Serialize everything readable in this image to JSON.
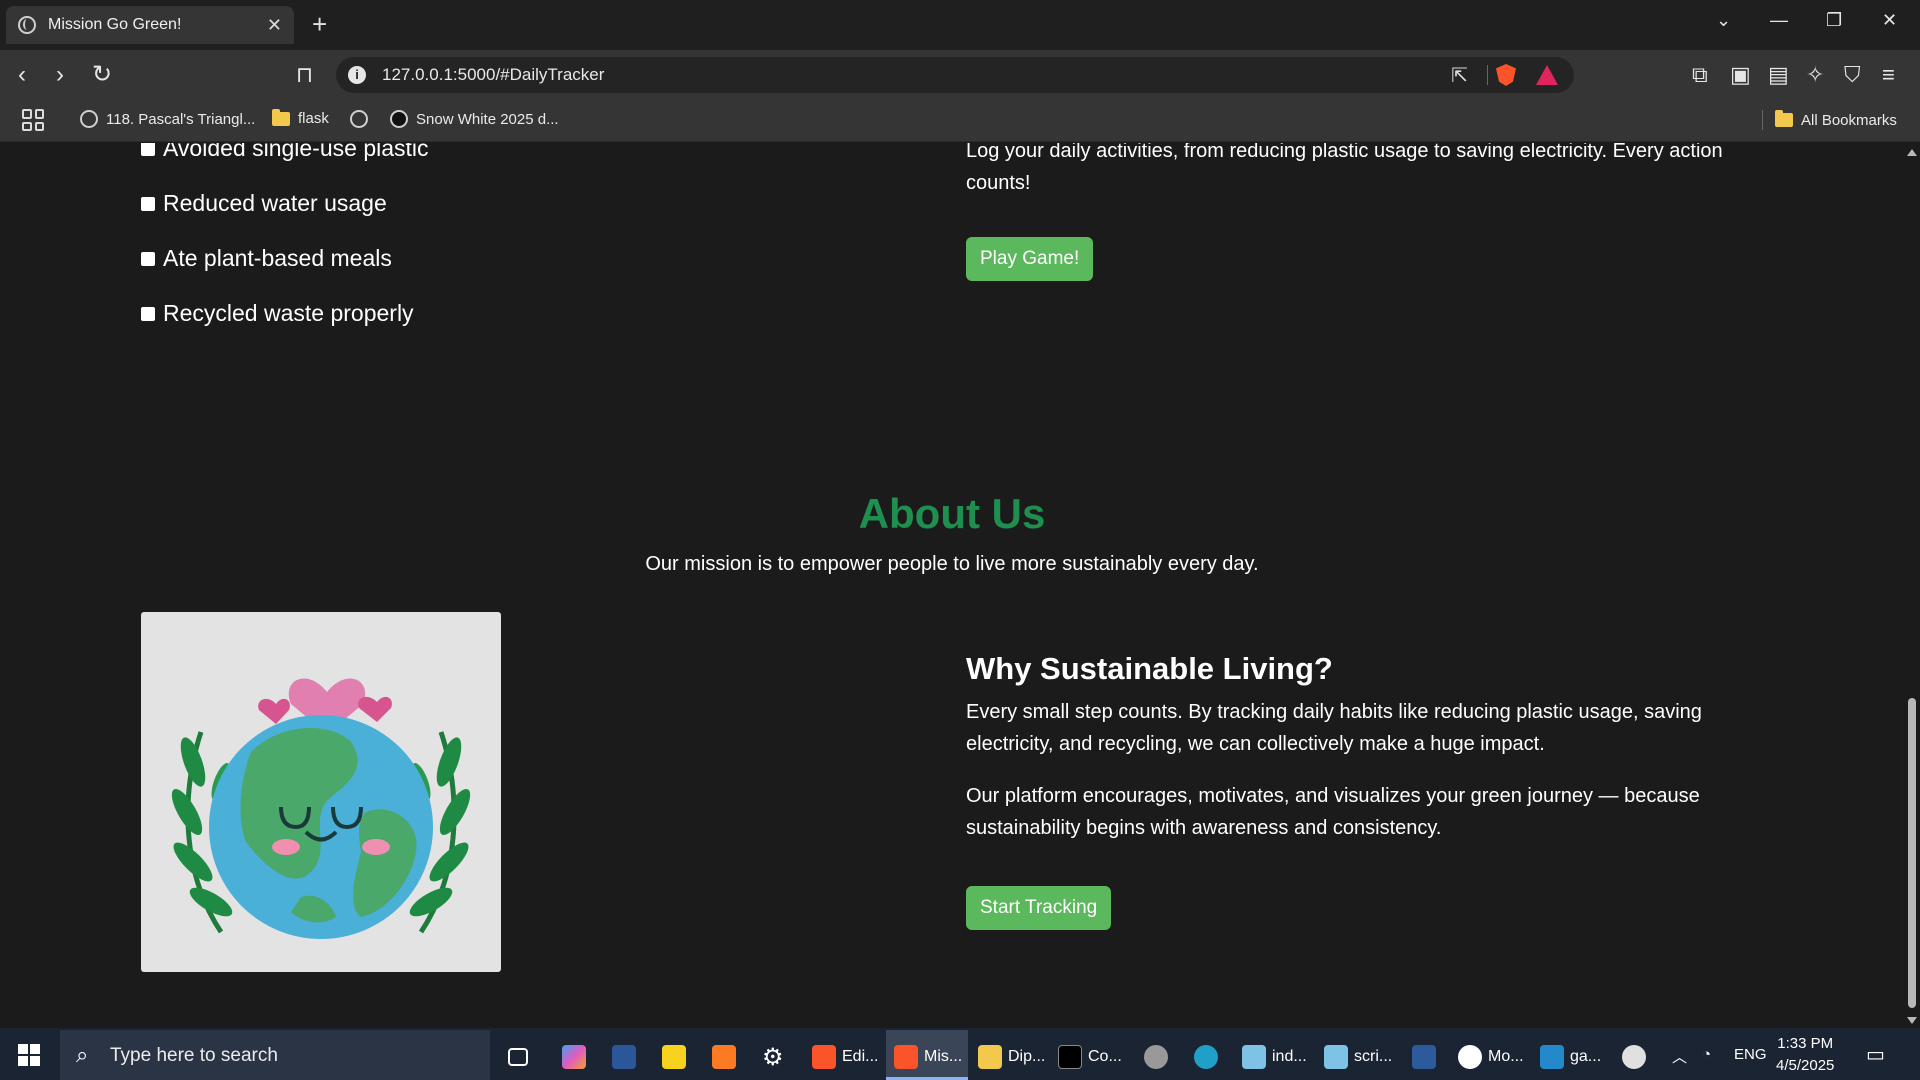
{
  "browser": {
    "tab_title": "Mission Go Green!",
    "tab_close": "✕",
    "new_tab": "+",
    "url": "127.0.0.1:5000/#DailyTracker",
    "bookmarks": [
      "118. Pascal's Triangl...",
      "flask",
      "Snow White 2025 d..."
    ],
    "all_bookmarks": "All Bookmarks"
  },
  "tracker": {
    "items": [
      "Avoided single-use plastic",
      "Reduced water usage",
      "Ate plant-based meals",
      "Recycled waste properly"
    ],
    "intro": "Log your daily activities, from reducing plastic usage to saving electricity. Every action counts!",
    "play_button": "Play Game!"
  },
  "about": {
    "title": "About Us",
    "subtitle": "Our mission is to empower people to live more sustainably every day.",
    "why_title": "Why Sustainable Living?",
    "para1": "Every small step counts. By tracking daily habits like reducing plastic usage, saving electricity, and recycling, we can collectively make a huge impact.",
    "para2": "Our platform encourages, motivates, and visualizes your green journey — because sustainability begins with awareness and consistency.",
    "start_button": "Start Tracking"
  },
  "taskbar": {
    "search_placeholder": "Type here to search",
    "items": [
      "Edi...",
      "Mis...",
      "Dip...",
      "Co...",
      "ind...",
      "scri...",
      "Mo...",
      "ga..."
    ],
    "language": "ENG",
    "time": "1:33 PM",
    "date": "4/5/2025"
  },
  "colors": {
    "accent_green": "#1e8f4e",
    "button_green": "#5cb85c",
    "page_bg": "#1c1b1b"
  }
}
